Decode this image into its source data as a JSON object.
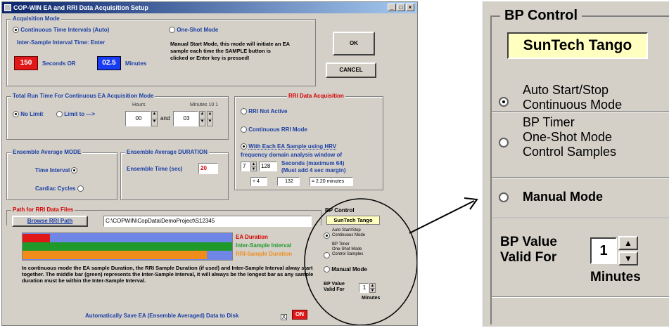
{
  "window": {
    "title": "COP-WIN  EA and RRI Data Acquisition  Setup",
    "min": "_",
    "max": "□",
    "close": "×"
  },
  "acq_mode": {
    "title": "Acquisition Mode",
    "continuous_label": "Continuous Time Intervals (Auto)",
    "oneshot_label": "One-Shot Mode",
    "inter_sample_label": "Inter-Sample  Interval  Time: Enter",
    "seconds_value": "150",
    "seconds_label": "Seconds  OR",
    "minutes_value": "02.5",
    "minutes_label": "Minutes",
    "oneshot_desc": "Manual Start Mode, this mode will initiate an EA sample each time the SAMPLE button is clicked or Enter key is pressed!"
  },
  "buttons": {
    "ok": "OK",
    "cancel": "CANCEL",
    "browse": "Browse RRI Path"
  },
  "run_time": {
    "title": "Total Run Time For Continuous EA Acquisition Mode",
    "no_limit": "No Limit",
    "limit_to": "Limit to --->",
    "hours_label": "Hours",
    "minutes_label": "Minutes  10   1",
    "hours_value": "00",
    "and_label": "and",
    "minutes_value": "03"
  },
  "rri": {
    "title": "RRI Data Acquisition",
    "not_active": "RRI Not Active",
    "continuous": "Continuous RRI Mode",
    "with_each": "With Each EA  Sample using HRV",
    "desc1": "frequency domain analysis window of",
    "n_value": "7",
    "seconds_value": "128",
    "seconds_note": "Seconds (maximum 64)",
    "margin_note": "(Must add 4 sec margin)",
    "plus4": "+ 4",
    "eq_value": "132",
    "minutes_text": "= 2.20 minutes"
  },
  "ens_mode": {
    "title": "Ensemble Average MODE",
    "time_interval": "Time Interval",
    "cardiac": "Cardiac Cycles"
  },
  "ens_duration": {
    "title": "Ensemble Average DURATION",
    "label": "Ensemble Time (sec)",
    "value": "20"
  },
  "path": {
    "title": "Path for RRI Data Files",
    "value": "C:\\COPWIN\\CopData\\DemoProject\\S12345"
  },
  "bars": {
    "ea_label": "EA Duration",
    "inter_label": "Inter-Sample Interval",
    "rri_label": "RRI-Sample Duration",
    "ea_fraction": 0.13,
    "inter_fraction": 1.0,
    "rri_fraction": 0.88,
    "ea_color": "#e01818",
    "inter_color": "#1f9a2a",
    "rri_color": "#f08c1a",
    "bg_color": "#6f86e6"
  },
  "info_text": "In continuous mode the EA sample Duration, the RRI Sample Duration (if used) and Inter-Sample Interval alway start together.  The middle bar (green) represents the Inter-Sample Interval, it will always be the longest bar as any sample duration must be within the Inter-Sample Interval.",
  "autosave": {
    "label": "Automatically Save EA (Ensemble Averaged) Data to Disk",
    "check": "X",
    "state": "ON"
  },
  "bp_control": {
    "title": "BP Control",
    "device": "SunTech Tango",
    "auto_line1": "Auto Start/Stop",
    "auto_line2": "Continuous Mode",
    "timer_line1": "BP Timer",
    "timer_line2": "One-Shot Mode",
    "timer_line3": "Control Samples",
    "manual": "Manual Mode",
    "valid_line1": "BP Value",
    "valid_line2": "Valid For",
    "valid_value": "1",
    "valid_units": "Minutes"
  }
}
